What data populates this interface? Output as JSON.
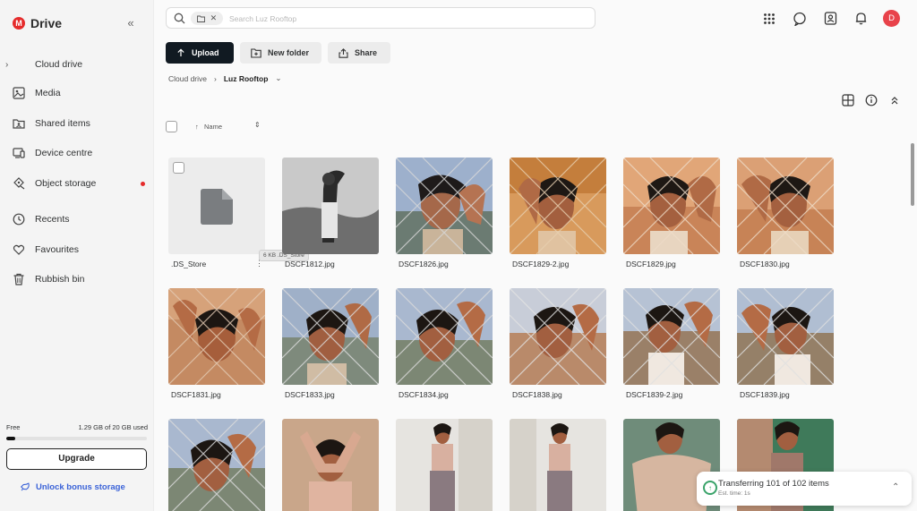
{
  "app": {
    "brand": "Drive",
    "logo_letter": "M",
    "accent": "#e52b2b"
  },
  "sidebar": {
    "collapse_icon": "double-chevron-left-icon",
    "items": [
      {
        "label": "Cloud drive",
        "icon": "cloud-drive-icon"
      },
      {
        "label": "Media",
        "icon": "media-icon"
      },
      {
        "label": "Shared items",
        "icon": "shared-items-icon"
      },
      {
        "label": "Device centre",
        "icon": "device-centre-icon"
      },
      {
        "label": "Object storage",
        "icon": "object-storage-icon"
      },
      {
        "label": "Recents",
        "icon": "recents-icon"
      },
      {
        "label": "Favourites",
        "icon": "favourites-icon"
      },
      {
        "label": "Rubbish bin",
        "icon": "rubbish-bin-icon"
      }
    ],
    "storage": {
      "plan": "Free",
      "used": "1.29 GB of 20 GB used",
      "fraction": 0.0645
    },
    "upgrade_label": "Upgrade",
    "bonus_label": "Unlock bonus storage"
  },
  "search": {
    "placeholder": "Search Luz Rooftop",
    "value": ""
  },
  "actions": {
    "upload": "Upload",
    "new_folder": "New folder",
    "share": "Share"
  },
  "breadcrumb": {
    "root": "Cloud drive",
    "current": "Luz Rooftop"
  },
  "list": {
    "sort_label": "Name"
  },
  "files": [
    {
      "name": ".DS_Store",
      "tooltip": "6 KB .DS_Store"
    },
    {
      "name": "DSCF1812.jpg"
    },
    {
      "name": "DSCF1826.jpg"
    },
    {
      "name": "DSCF1829-2.jpg"
    },
    {
      "name": "DSCF1829.jpg"
    },
    {
      "name": "DSCF1830.jpg"
    },
    {
      "name": "DSCF1831.jpg"
    },
    {
      "name": "DSCF1833.jpg"
    },
    {
      "name": "DSCF1834.jpg"
    },
    {
      "name": "DSCF1838.jpg"
    },
    {
      "name": "DSCF1839-2.jpg"
    },
    {
      "name": "DSCF1839.jpg"
    }
  ],
  "user": {
    "avatar_letter": "D",
    "avatar_color": "#e8424a"
  },
  "transfer": {
    "title": "Transferring 101 of 102 items",
    "eta": "Est. time: 1s"
  }
}
